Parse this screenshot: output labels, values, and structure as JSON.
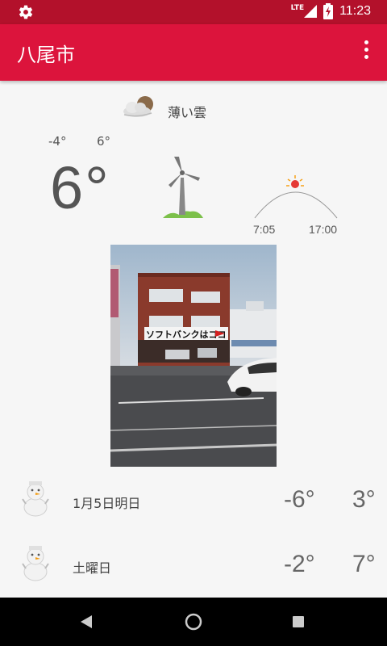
{
  "status_bar": {
    "network": "LTE",
    "time": "11:23"
  },
  "app_bar": {
    "title": "八尾市"
  },
  "current": {
    "condition": "薄い雲",
    "temp_low": "-4°",
    "temp_high": "6°",
    "temp_now": "6°",
    "sunrise": "7:05",
    "sunset": "17:00"
  },
  "photo": {
    "sign_text": "ソフトバンクはココ"
  },
  "forecast": [
    {
      "label": "1月5日明日",
      "low": "-6°",
      "high": "3°",
      "icon": "snowman-icon"
    },
    {
      "label": "土曜日",
      "low": "-2°",
      "high": "7°",
      "icon": "snowman-icon"
    }
  ],
  "colors": {
    "status_bar": "#b3112b",
    "app_bar": "#dc143c"
  }
}
